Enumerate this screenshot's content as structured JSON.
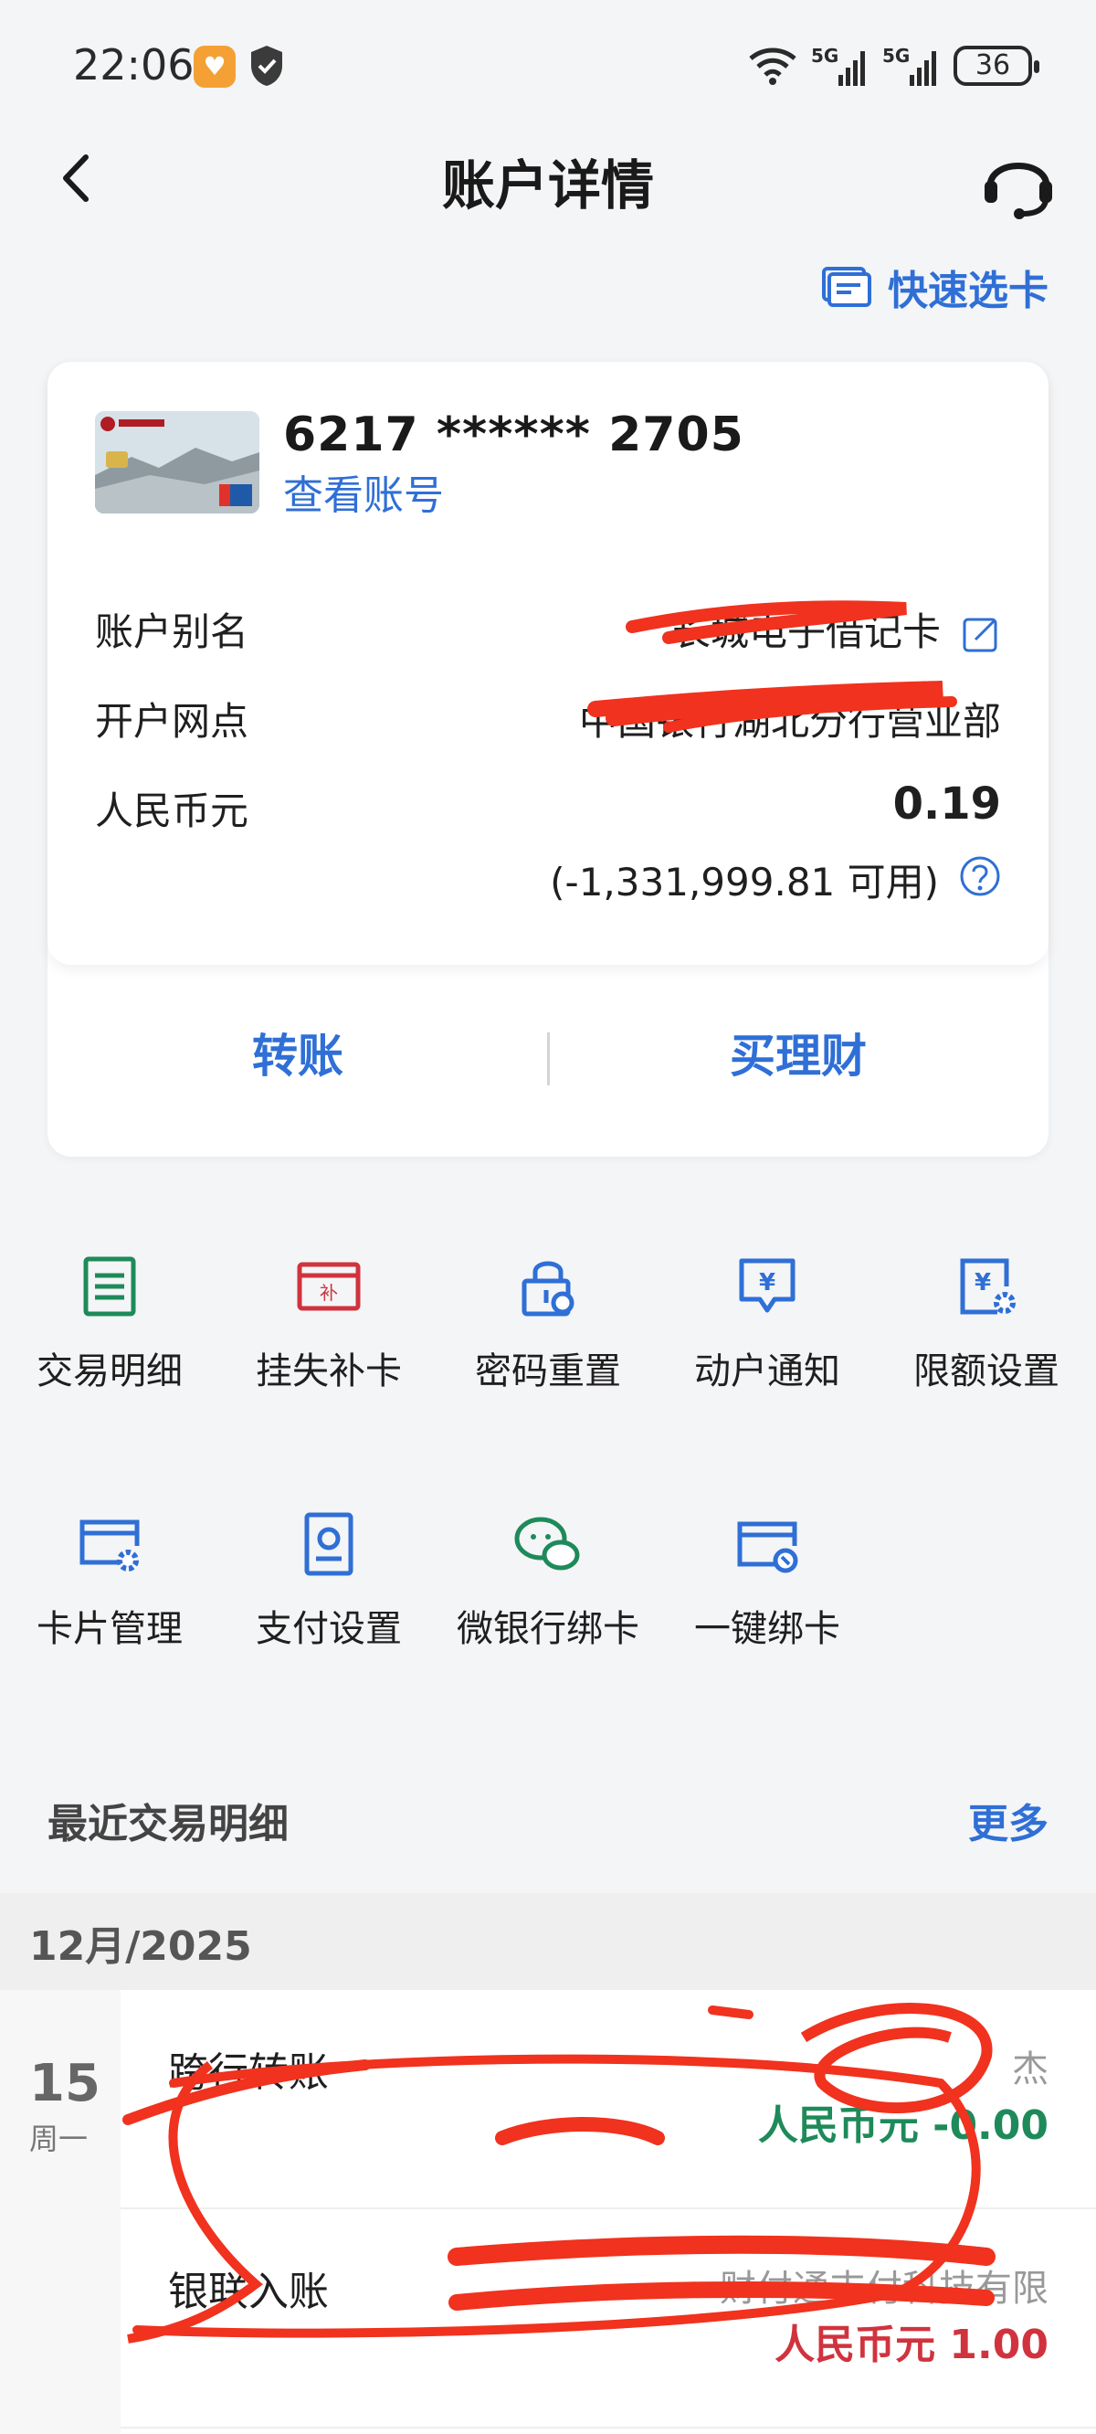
{
  "status_bar": {
    "time": "22:06",
    "signal_labels": [
      "5G",
      "5G"
    ],
    "battery": "36"
  },
  "nav": {
    "title": "账户详情"
  },
  "quick_select": {
    "label": "快速选卡"
  },
  "card": {
    "number": "6217 ****** 2705",
    "view_account": "查看账号",
    "alias_label": "账户别名",
    "alias_value": "长城电子借记卡",
    "branch_label": "开户网点",
    "branch_value": "中国银行湖北分行营业部",
    "currency_label": "人民币元",
    "balance": "0.19",
    "available": "(-1,331,999.81 可用)",
    "actions": {
      "transfer": "转账",
      "buy_wealth": "买理财"
    }
  },
  "services": [
    {
      "label": "交易明细",
      "icon": "list-icon",
      "color": "#1e8a5a"
    },
    {
      "label": "挂失补卡",
      "icon": "report-loss-icon",
      "color": "#d0333e"
    },
    {
      "label": "密码重置",
      "icon": "lock-reset-icon",
      "color": "#2f6fd6"
    },
    {
      "label": "动户通知",
      "icon": "notify-icon",
      "color": "#2f6fd6"
    },
    {
      "label": "限额设置",
      "icon": "limit-settings-icon",
      "color": "#2f6fd6"
    },
    {
      "label": "卡片管理",
      "icon": "card-manage-icon",
      "color": "#2f6fd6"
    },
    {
      "label": "支付设置",
      "icon": "payment-settings-icon",
      "color": "#2f6fd6"
    },
    {
      "label": "微银行绑卡",
      "icon": "wechat-bind-icon",
      "color": "#1e8a5a"
    },
    {
      "label": "一键绑卡",
      "icon": "one-click-bind-icon",
      "color": "#2f6fd6"
    }
  ],
  "recent": {
    "header": "最近交易明细",
    "more": "更多",
    "month": "12月/2025",
    "day": "15",
    "weekday": "周一",
    "transactions": [
      {
        "type": "跨行转账",
        "counterparty": "杰",
        "amount": "人民币元 -0.00",
        "amount_color": "#1e8a5a"
      },
      {
        "type": "银联入账",
        "counterparty": "财付通支付科技有限",
        "amount": "人民币元 1.00",
        "amount_color": "#d0333e"
      }
    ]
  },
  "colors": {
    "accent": "#2f6fd6",
    "redact": "#f0321e"
  }
}
